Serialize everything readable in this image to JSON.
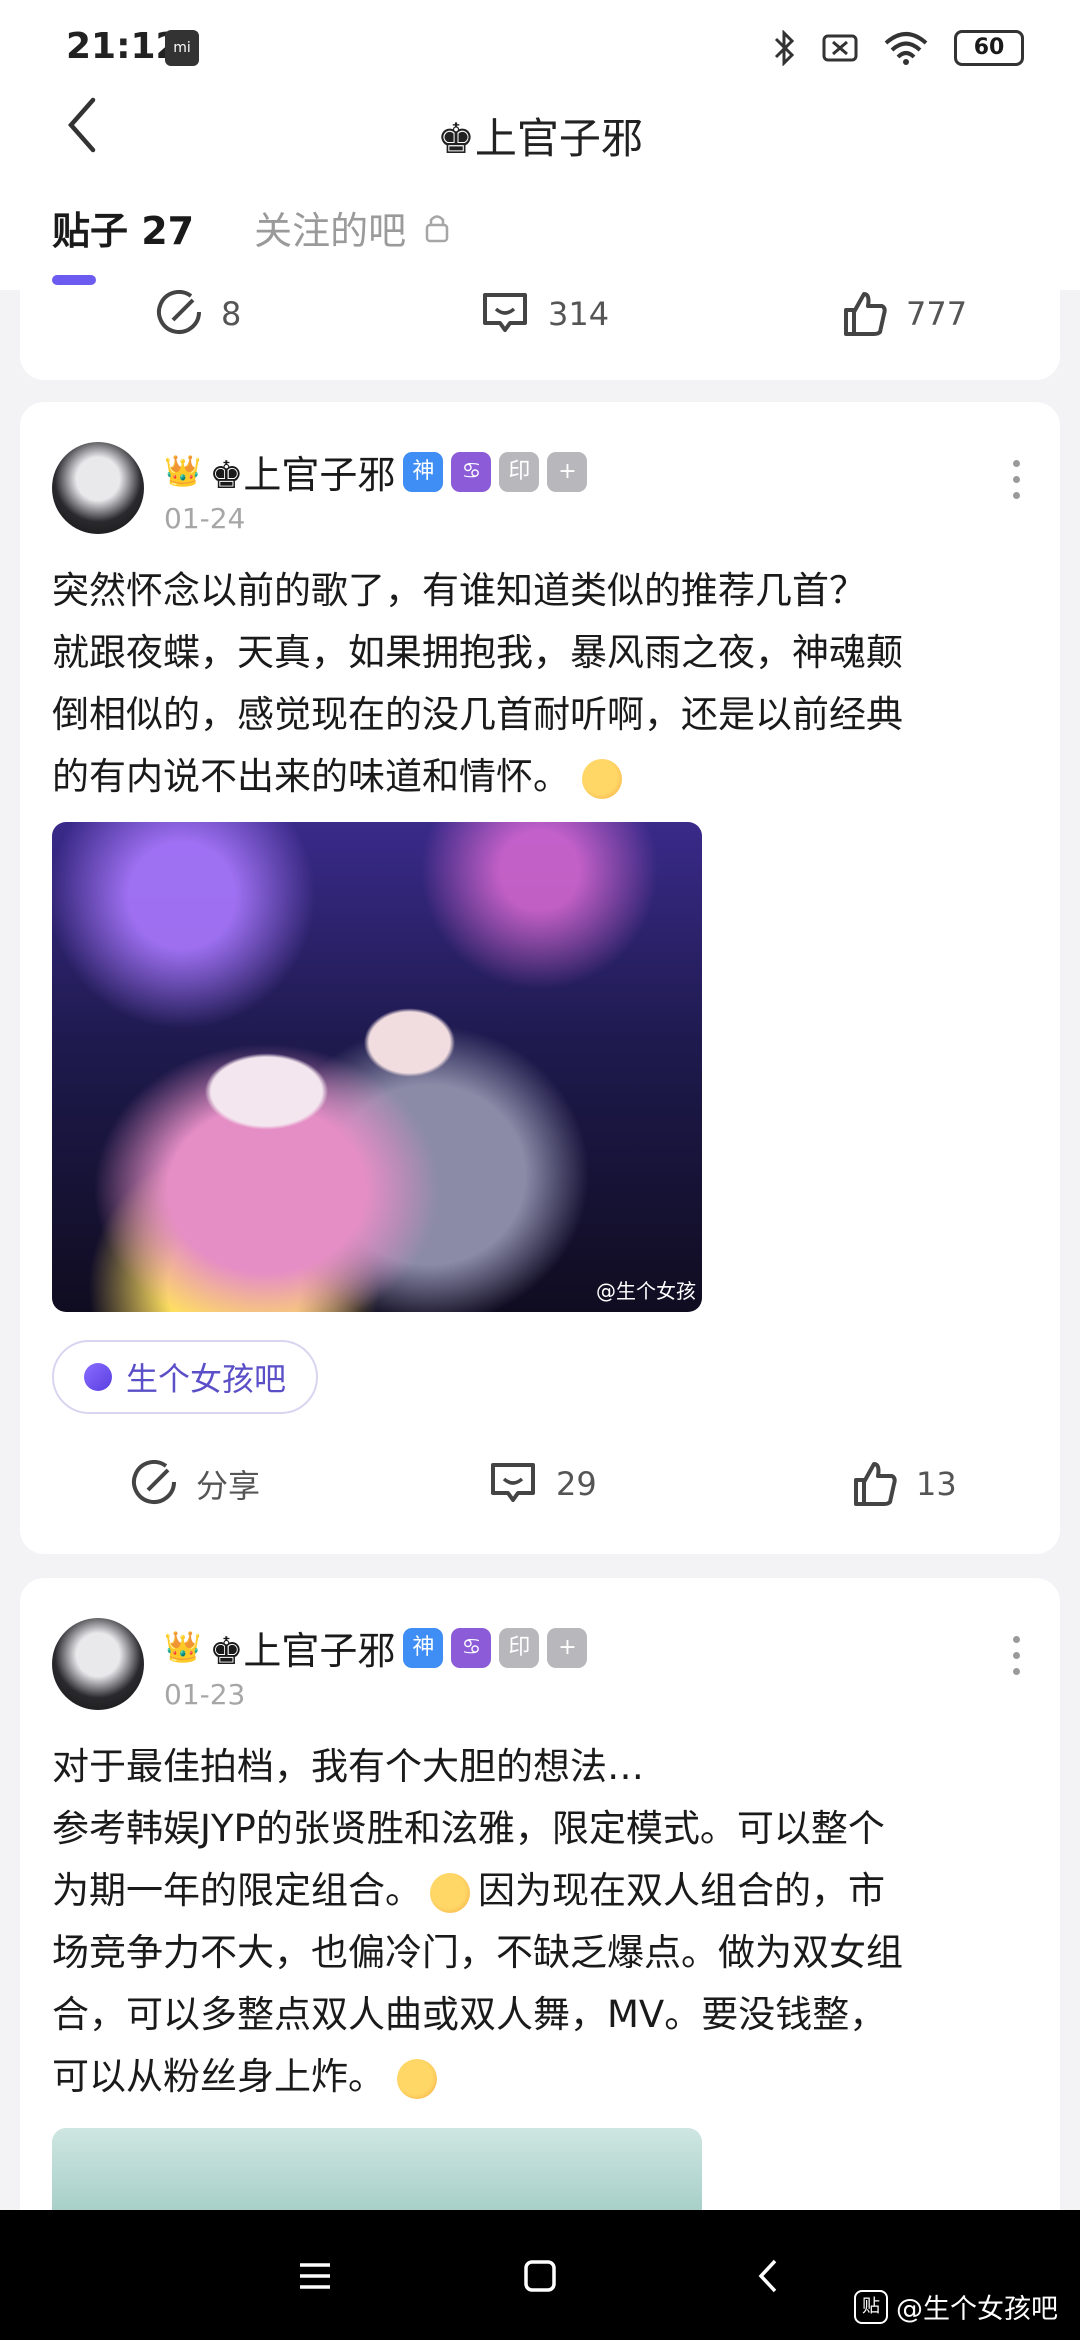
{
  "status_bar": {
    "time": "21:12",
    "mi_label": "mi",
    "battery": "60"
  },
  "header": {
    "title": "♚上官子邪",
    "back_icon": "chevron-left-icon"
  },
  "tabs": [
    {
      "label": "贴子 27",
      "active": true
    },
    {
      "label": "关注的吧",
      "active": false,
      "icon": "lock-icon"
    }
  ],
  "card0": {
    "share_count": "8",
    "comment_count": "314",
    "like_count": "777"
  },
  "posts": [
    {
      "crown": "👑",
      "username": "♚上官子邪",
      "badges": [
        "神",
        "♋",
        "印",
        "+"
      ],
      "date": "01-24",
      "lines": [
        "突然怀念以前的歌了，有谁知道类似的推荐几首？",
        "就跟夜蝶，天真，如果拥抱我，暴风雨之夜，神魂颠",
        "倒相似的，感觉现在的没几首耐听啊，还是以前经典",
        "的有内说不出来的味道和情怀。"
      ],
      "image_watermark": "@生个女孩",
      "forum": "生个女孩吧",
      "share_label": "分享",
      "comment_count": "29",
      "like_count": "13"
    },
    {
      "crown": "👑",
      "username": "♚上官子邪",
      "badges": [
        "神",
        "♋",
        "印",
        "+"
      ],
      "date": "01-23",
      "lines": [
        "对于最佳拍档，我有个大胆的想法…",
        "参考韩娱JYP的张贤胜和泫雅，限定模式。可以整个",
        "为期一年的限定组合。",
        "因为现在双人组合的，市",
        "场竞争力不大，也偏冷门，不缺乏爆点。做为双女组",
        "合，可以多整点双人曲或双人舞，MV。要没钱整，",
        "可以从粉丝身上炸。"
      ]
    }
  ],
  "nav": {
    "watermark_logo": "贴",
    "watermark": "@生个女孩吧"
  },
  "colors": {
    "accent": "#6b5bf0",
    "forum_text": "#5b4fc8"
  }
}
